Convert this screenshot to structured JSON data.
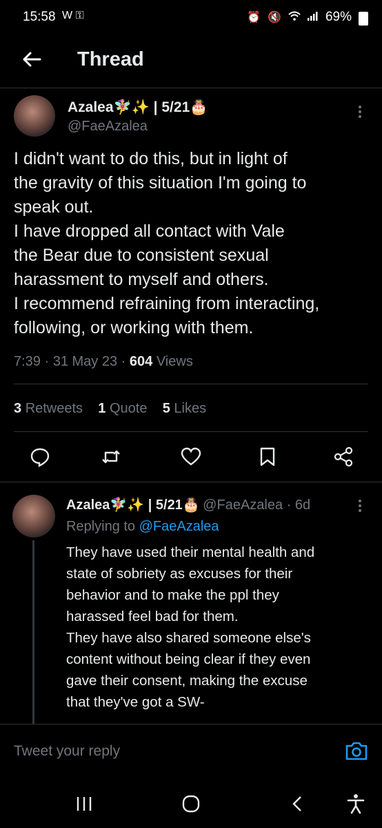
{
  "status_bar": {
    "time": "15:58",
    "left_icons": "W ⚿",
    "battery": "69%"
  },
  "header": {
    "title": "Thread"
  },
  "main_tweet": {
    "display_name": "Azalea🧚‍♀️✨ | 5/21🎂",
    "handle": "@FaeAzalea",
    "text": "I didn't want to do this, but in light of\nthe gravity of this situation I'm going to\nspeak out.\nI have dropped all contact with Vale\nthe Bear due to consistent sexual\nharassment to myself and others.\nI recommend refraining from interacting,\nfollowing, or working with them.",
    "time": "7:39",
    "date": "31 May 23",
    "views_count": "604",
    "views_label": "Views",
    "retweets_count": "3",
    "retweets_label": "Retweets",
    "quotes_count": "1",
    "quotes_label": "Quote",
    "likes_count": "5",
    "likes_label": "Likes"
  },
  "reply_tweet": {
    "display_name": "Azalea🧚‍♀️✨ | 5/21🎂",
    "handle_time": "@FaeAzalea · 6d",
    "replying_prefix": "Replying to",
    "replying_handle": "@FaeAzalea",
    "text": "They have used their mental health and\nstate of sobriety as excuses for their\nbehavior and to make the ppl they\nharassed feel bad for them.\nThey have also shared someone else's\ncontent without being clear if they even\ngave their consent, making the excuse\nthat they've got a SW-"
  },
  "reply_bar": {
    "placeholder": "Tweet your reply"
  },
  "colors": {
    "background": "#000000",
    "text": "#e7e9ea",
    "secondary": "#71767b",
    "accent": "#1d9bf0",
    "divider": "#2f3336"
  },
  "icons": {
    "reply": "speech-bubble-icon",
    "retweet": "retweet-icon",
    "like": "heart-icon",
    "bookmark": "bookmark-icon",
    "share": "share-icon",
    "camera": "camera-icon",
    "back": "arrow-left-icon"
  }
}
